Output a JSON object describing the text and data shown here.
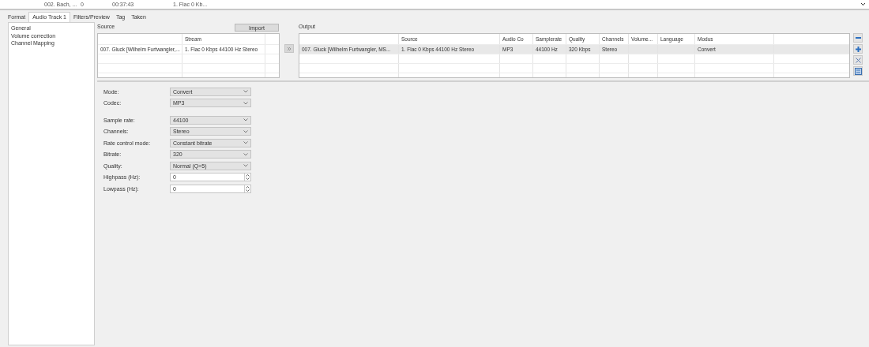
{
  "top_list": {
    "row": [
      "002. Bach, ...",
      "0",
      "00:37:43",
      "1. Flac 0 Kb..."
    ]
  },
  "tabs": [
    {
      "label": "Format",
      "selected": false
    },
    {
      "label": "Audio Track 1",
      "selected": true
    },
    {
      "label": "Filters/Preview",
      "selected": false
    },
    {
      "label": "Tag",
      "selected": false
    },
    {
      "label": "Taken",
      "selected": false
    }
  ],
  "sidebar": {
    "items": [
      {
        "label": "General"
      },
      {
        "label": "Volume correction"
      },
      {
        "label": "Channel Mapping"
      }
    ]
  },
  "source": {
    "label": "Source",
    "import_button": "Import",
    "headers": [
      "Stream"
    ],
    "rows": [
      {
        "selected": false,
        "cells": [
          "007. Gluck [Wilhelm Furtwangler,...",
          "1. Flac 0 Kbps 44100 Hz Stereo"
        ]
      }
    ]
  },
  "output": {
    "label": "Output",
    "headers": [
      "Source",
      "Audio Co",
      "Samplerate",
      "Quality",
      "Channels",
      "Volume...",
      "Language",
      "Modus"
    ],
    "rows": [
      {
        "selected": true,
        "cells": [
          "007. Gluck [Wilhelm Furtwangler, MS...",
          "1. Flac 0 Kbps 44100 Hz Stereo",
          "MP3",
          "44100 Hz",
          "320 Kbps",
          "Stereo",
          "",
          "",
          "Convert"
        ]
      }
    ]
  },
  "side_buttons": [
    {
      "kind": "minus"
    },
    {
      "kind": "plus"
    },
    {
      "kind": "cross"
    },
    {
      "kind": "settings"
    }
  ],
  "form": {
    "groups": [
      [
        {
          "kind": "select",
          "label": "Mode:",
          "value": "Convert"
        },
        {
          "kind": "select",
          "label": "Codec:",
          "value": "MP3"
        }
      ],
      [
        {
          "kind": "select",
          "label": "Sample rate:",
          "value": "44100"
        },
        {
          "kind": "select",
          "label": "Channels:",
          "value": "Stereo"
        },
        {
          "kind": "select",
          "label": "Rate control mode:",
          "value": "Constant bitrate"
        },
        {
          "kind": "select",
          "label": "Bitrate:",
          "value": "320"
        },
        {
          "kind": "select",
          "label": "Quality:",
          "value": "Normal (Q=5)"
        },
        {
          "kind": "spin",
          "label": "Highpass (Hz):",
          "value": "0"
        },
        {
          "kind": "spin",
          "label": "Lowpass (Hz):",
          "value": "0"
        }
      ]
    ]
  }
}
